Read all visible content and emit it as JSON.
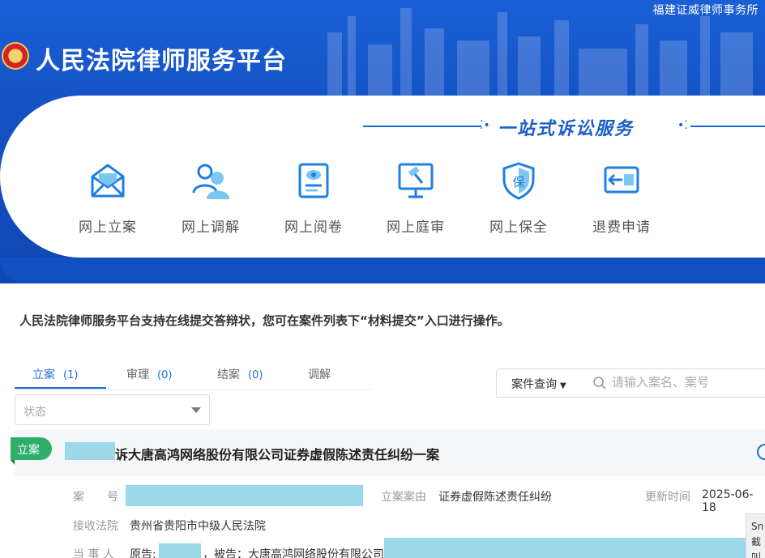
{
  "header": {
    "firm": "福建证威律师事务所",
    "site_title": "人民法院律师服务平台",
    "tagline": "一站式诉讼服务"
  },
  "services": [
    {
      "label": "网上立案",
      "icon": "envelope-icon"
    },
    {
      "label": "网上调解",
      "icon": "people-icon"
    },
    {
      "label": "网上阅卷",
      "icon": "document-eye-icon"
    },
    {
      "label": "网上庭审",
      "icon": "gavel-screen-icon"
    },
    {
      "label": "网上保全",
      "icon": "shield-bao-icon"
    },
    {
      "label": "退费申请",
      "icon": "refund-icon"
    }
  ],
  "notice": "人民法院律师服务平台支持在线提交答辩状，您可在案件列表下“材料提交”入口进行操作。",
  "tabs": [
    {
      "label": "立案",
      "count": "(1)"
    },
    {
      "label": "审理",
      "count": "(0)"
    },
    {
      "label": "结案",
      "count": "(0)"
    },
    {
      "label": "调解",
      "count": ""
    }
  ],
  "filters": {
    "status_placeholder": "状态",
    "query_label": "案件查询",
    "search_placeholder": "请输入案名、案号"
  },
  "case": {
    "badge": "立案",
    "title": "诉大唐高鸿网络股份有限公司证券虚假陈述责任纠纷一案",
    "case_no_label": "案　　号",
    "cause_label": "立案案由",
    "cause_value": "证券虚假陈述责任纠纷",
    "updated_label": "更新时间",
    "updated_value": "2025-06-18",
    "court_label": "接收法院",
    "court_value": "贵州省贵阳市中级人民法院",
    "party_label": "当 事 人",
    "plaintiff_prefix": "原告:",
    "defendant_text": "，被告：大唐高鸿网络股份有限公司"
  },
  "snip_tool": {
    "line1": "Sn",
    "line2": "截",
    "line3": "叫"
  },
  "colors": {
    "primary": "#1e6fd9",
    "banner": "#1452c4",
    "badge": "#2fae6a",
    "redaction": "#9ad8ea"
  }
}
